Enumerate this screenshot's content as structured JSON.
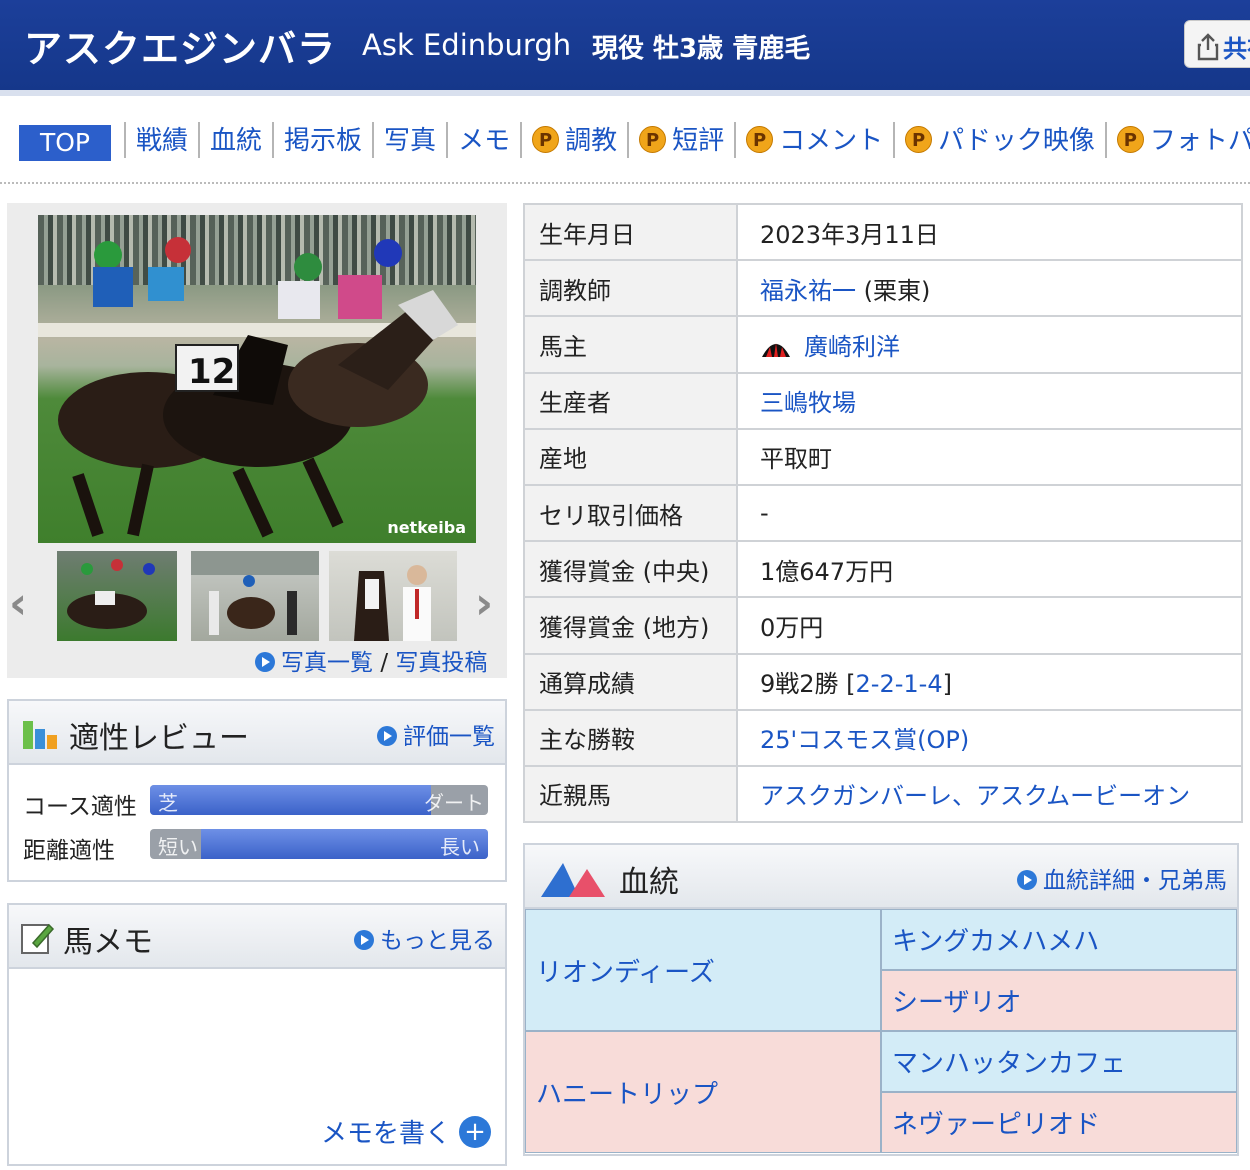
{
  "header": {
    "name_ja": "アスクエジンバラ",
    "name_en": "Ask Edinburgh",
    "status": "現役 牡3歳 青鹿毛",
    "share_label": "共有"
  },
  "nav": {
    "top": "TOP",
    "items": [
      {
        "label": "戦績",
        "premium": false
      },
      {
        "label": "血統",
        "premium": false
      },
      {
        "label": "掲示板",
        "premium": false
      },
      {
        "label": "写真",
        "premium": false
      },
      {
        "label": "メモ",
        "premium": false
      },
      {
        "label": "調教",
        "premium": true
      },
      {
        "label": "短評",
        "premium": true
      },
      {
        "label": "コメント",
        "premium": true
      },
      {
        "label": "パドック映像",
        "premium": true
      },
      {
        "label": "フォトパドック",
        "premium": true
      }
    ],
    "premium_badge": "P"
  },
  "photo": {
    "watermark": "netkeiba",
    "list_link": "写真一覧",
    "separator": "/",
    "post_link": "写真投稿",
    "prev_icon": "chevron-left-icon",
    "next_icon": "chevron-right-icon"
  },
  "review": {
    "title": "適性レビュー",
    "link": "評価一覧",
    "course": {
      "label": "コース適性",
      "left": "芝",
      "right": "ダート",
      "value": 0.83
    },
    "distance": {
      "label": "距離適性",
      "left": "短い",
      "right": "長い",
      "value": 0.15
    }
  },
  "memo": {
    "title": "馬メモ",
    "more_link": "もっと見る",
    "write_label": "メモを書く"
  },
  "profile": {
    "birth": {
      "label": "生年月日",
      "value": "2023年3月11日"
    },
    "trainer": {
      "label": "調教師",
      "name": "福永祐一",
      "extra": " (栗東)"
    },
    "owner": {
      "label": "馬主",
      "name": "廣崎利洋"
    },
    "breeder": {
      "label": "生産者",
      "name": "三嶋牧場"
    },
    "origin": {
      "label": "産地",
      "value": "平取町"
    },
    "auction": {
      "label": "セリ取引価格",
      "value": "-"
    },
    "prize_central": {
      "label": "獲得賞金 (中央)",
      "value": "1億647万円"
    },
    "prize_local": {
      "label": "獲得賞金 (地方)",
      "value": "0万円"
    },
    "record": {
      "label": "通算成績",
      "prefix": "9戦2勝 [",
      "link": "2-2-1-4",
      "suffix": "]"
    },
    "wins": {
      "label": "主な勝鞍",
      "value": "25'コスモス賞(OP)"
    },
    "relatives": {
      "label": "近親馬",
      "value": "アスクガンバーレ、アスクムービーオン"
    }
  },
  "pedigree": {
    "title": "血統",
    "link": "血統詳細・兄弟馬",
    "sire": "リオンディーズ",
    "sire_sire": "キングカメハメハ",
    "sire_dam": "シーザリオ",
    "dam": "ハニートリップ",
    "dam_sire": "マンハッタンカフェ",
    "dam_dam": "ネヴァーピリオド"
  },
  "colors": {
    "header_bg": "#1c3f9a",
    "link": "#1a55c4",
    "pedigree_sire": "#d3ecf7",
    "pedigree_dam": "#f8dcd9"
  }
}
